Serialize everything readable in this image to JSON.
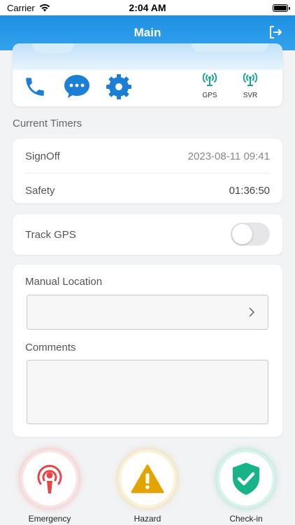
{
  "status_bar": {
    "carrier": "Carrier",
    "time": "2:04 AM"
  },
  "header": {
    "title": "Main"
  },
  "quick_actions": {
    "gps_label": "GPS",
    "svr_label": "SVR"
  },
  "timers": {
    "section_title": "Current Timers",
    "signoff_label": "SignOff",
    "signoff_value": "2023-08-11 09:41",
    "safety_label": "Safety",
    "safety_value": "01:36:50"
  },
  "track_gps": {
    "label": "Track GPS",
    "enabled": false
  },
  "form": {
    "manual_location_label": "Manual Location",
    "manual_location_value": "",
    "comments_label": "Comments",
    "comments_value": ""
  },
  "actions": {
    "emergency": "Emergency",
    "hazard": "Hazard",
    "checkin": "Check-in"
  },
  "colors": {
    "header": "#1e8fe0",
    "icon_blue": "#1b7fd6",
    "signal_green": "#1aa89a",
    "emergency_red": "#e84545",
    "hazard_yellow": "#e3a400",
    "checkin_green": "#17b389"
  }
}
